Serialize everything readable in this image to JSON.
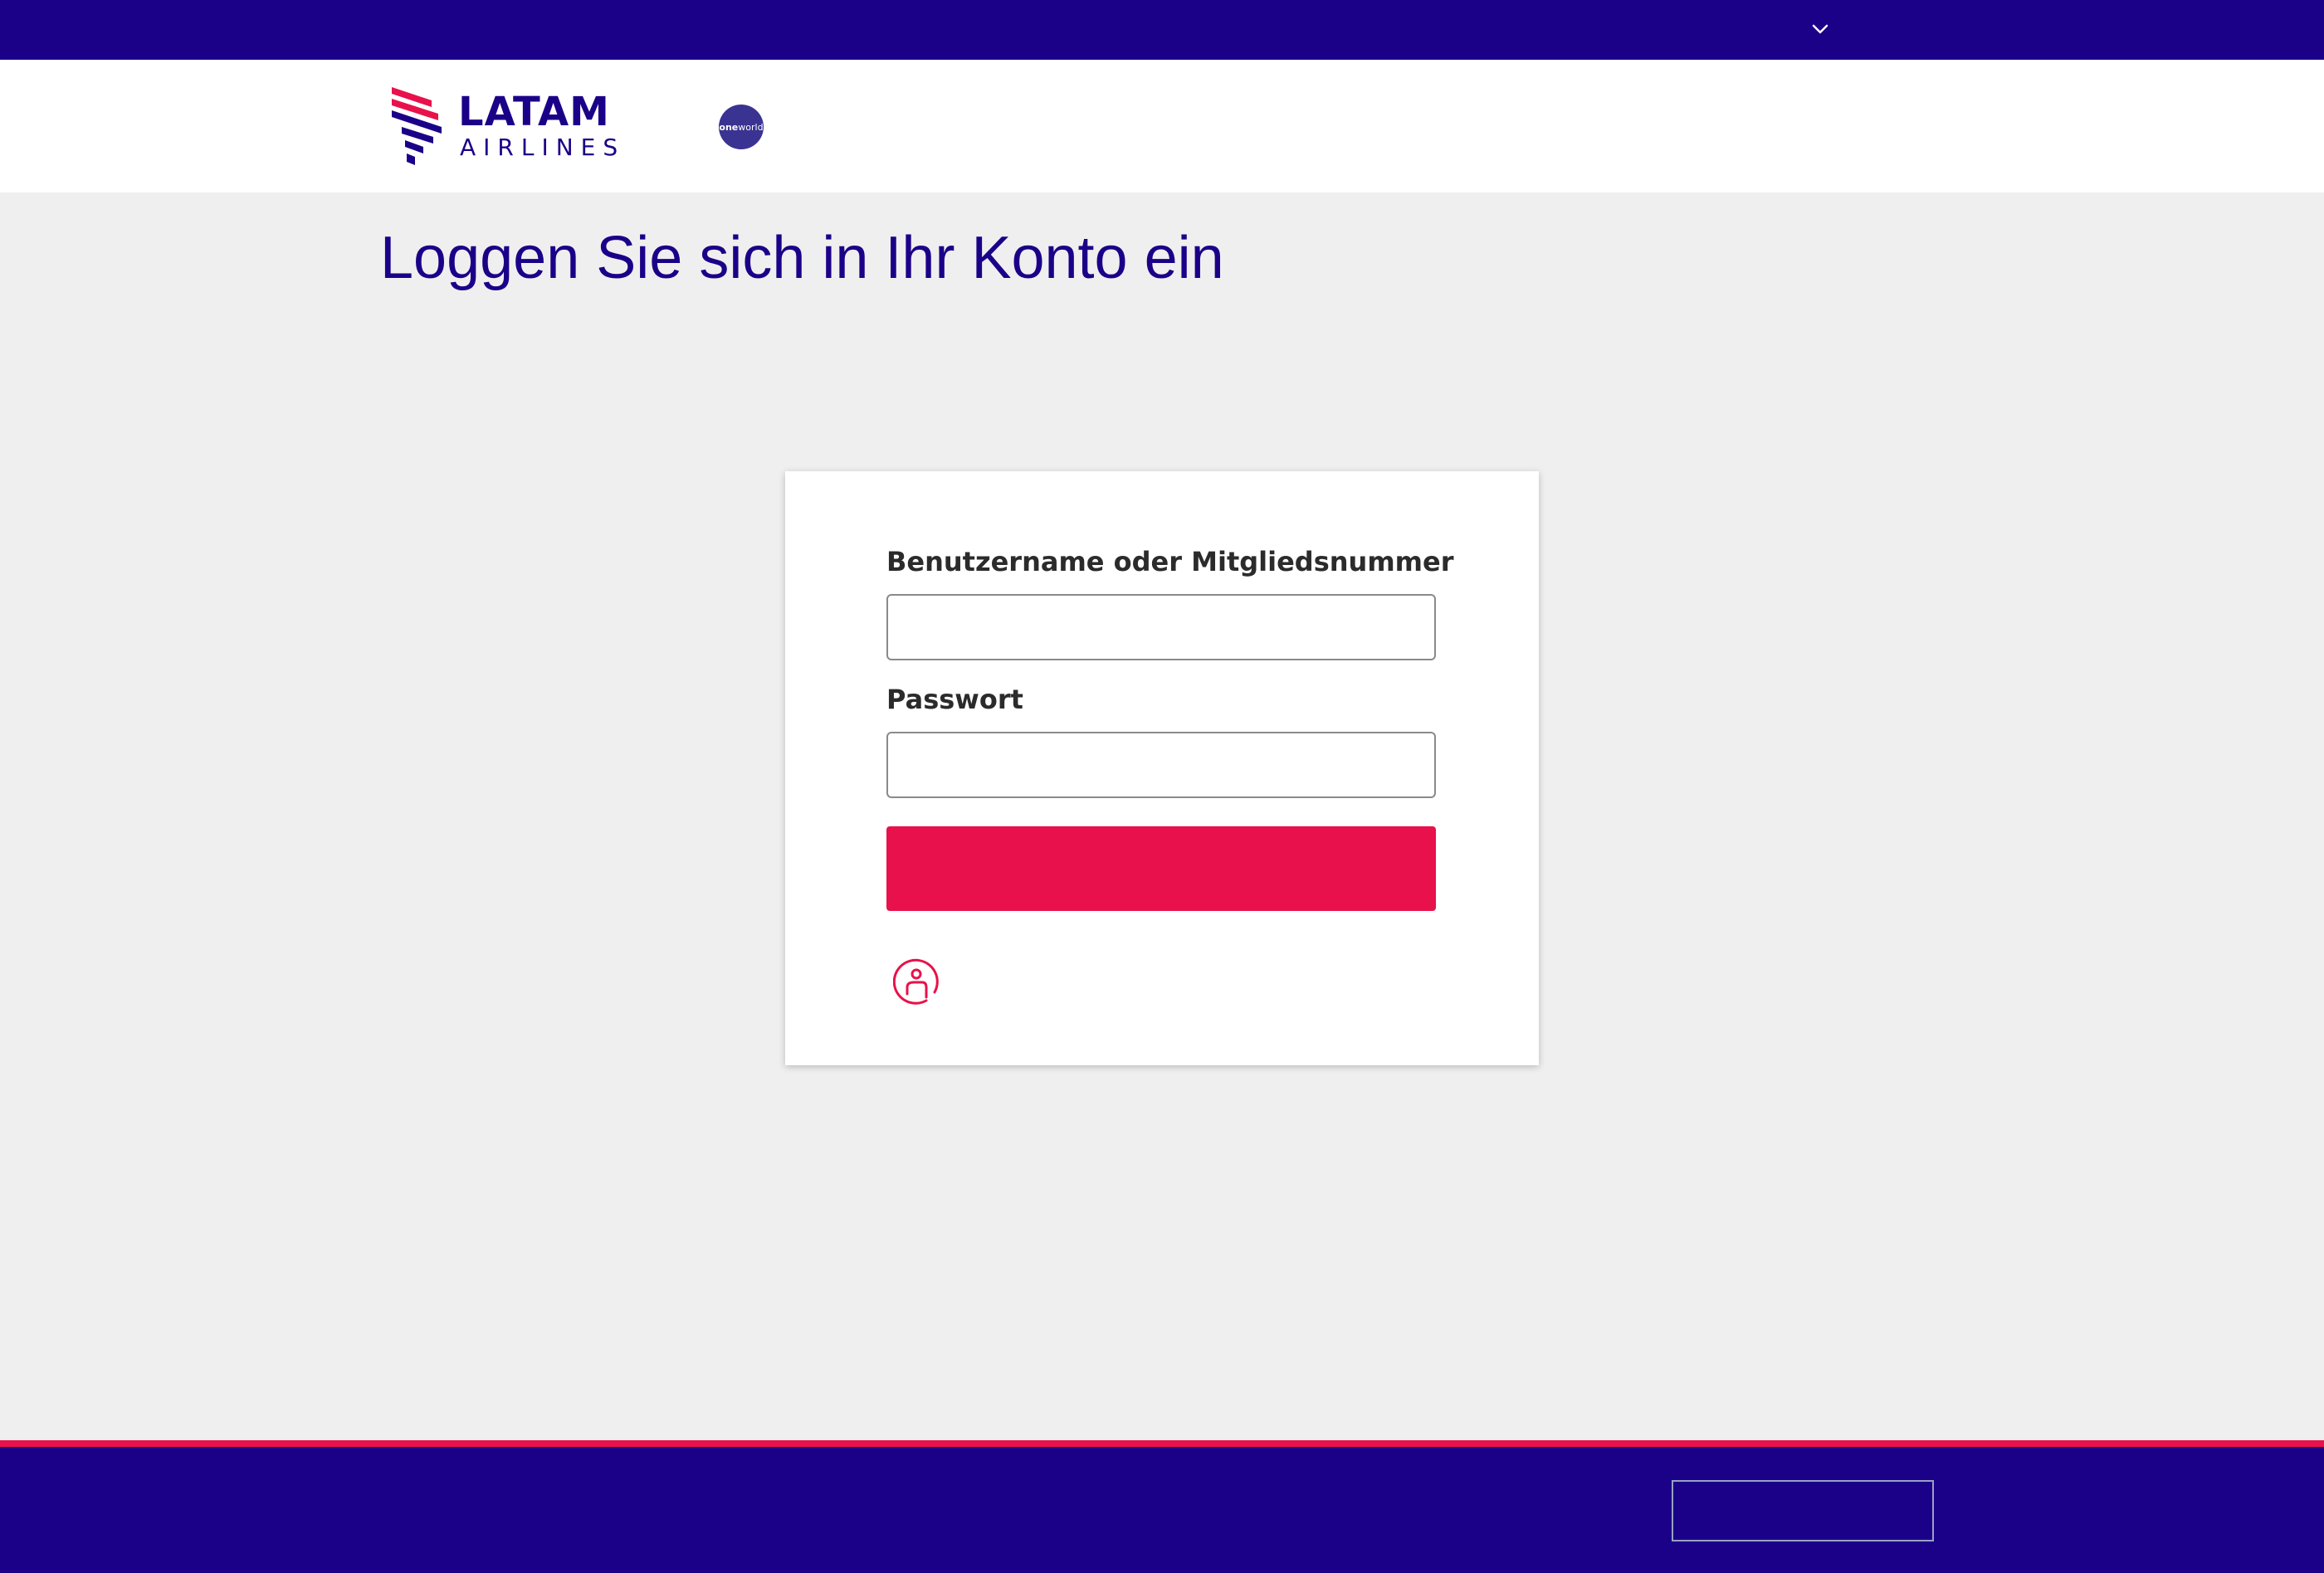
{
  "topbar": {
    "dropdown_icon": "chevron-down-icon"
  },
  "header": {
    "logo_line1": "LATAM",
    "logo_line2": "AIRLINES",
    "alliance_badge_bold": "one",
    "alliance_badge_rest": "world"
  },
  "page": {
    "title": "Loggen Sie sich in Ihr Konto ein"
  },
  "login_form": {
    "username_label": "Benutzername oder Mitgliedsnummer",
    "username_value": "",
    "password_label": "Passwort",
    "password_value": "",
    "submit_label": "",
    "account_icon": "user-circle-icon"
  },
  "footer": {
    "button_label": ""
  },
  "colors": {
    "brand_indigo": "#1b0088",
    "brand_coral": "#e8114b",
    "background": "#efefef",
    "card": "#ffffff"
  }
}
